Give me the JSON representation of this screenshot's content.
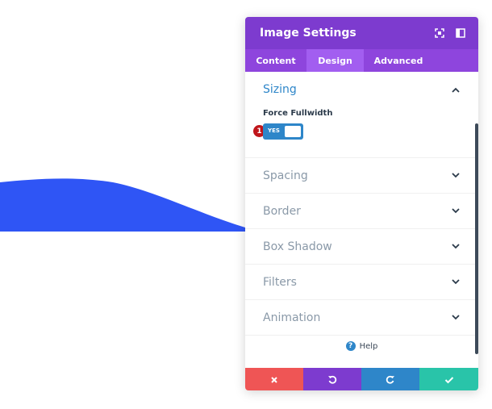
{
  "canvas": {
    "wave_color": "#2f55f5"
  },
  "panel": {
    "title": "Image Settings",
    "header_icons": [
      "fullscreen-icon",
      "split-view-icon"
    ],
    "tabs": [
      {
        "label": "Content",
        "active": false
      },
      {
        "label": "Design",
        "active": true
      },
      {
        "label": "Advanced",
        "active": false
      }
    ],
    "sections": [
      {
        "title": "Sizing",
        "expanded": true
      },
      {
        "title": "Spacing",
        "expanded": false
      },
      {
        "title": "Border",
        "expanded": false
      },
      {
        "title": "Box Shadow",
        "expanded": false
      },
      {
        "title": "Filters",
        "expanded": false
      },
      {
        "title": "Animation",
        "expanded": false
      }
    ],
    "sizing": {
      "field_label": "Force Fullwidth",
      "toggle_label": "YES",
      "toggle_on": true,
      "badge": "1"
    },
    "help_label": "Help",
    "footer_buttons": [
      {
        "icon": "close-icon",
        "color": "#ef5555"
      },
      {
        "icon": "undo-icon",
        "color": "#7d3bcf"
      },
      {
        "icon": "redo-icon",
        "color": "#2e86c9"
      },
      {
        "icon": "check-icon",
        "color": "#29c4a9"
      }
    ],
    "colors": {
      "header": "#7d3bcf",
      "tabs": "#8e45dd",
      "active_tab": "#a25ef0",
      "accent": "#2e86c9"
    }
  }
}
